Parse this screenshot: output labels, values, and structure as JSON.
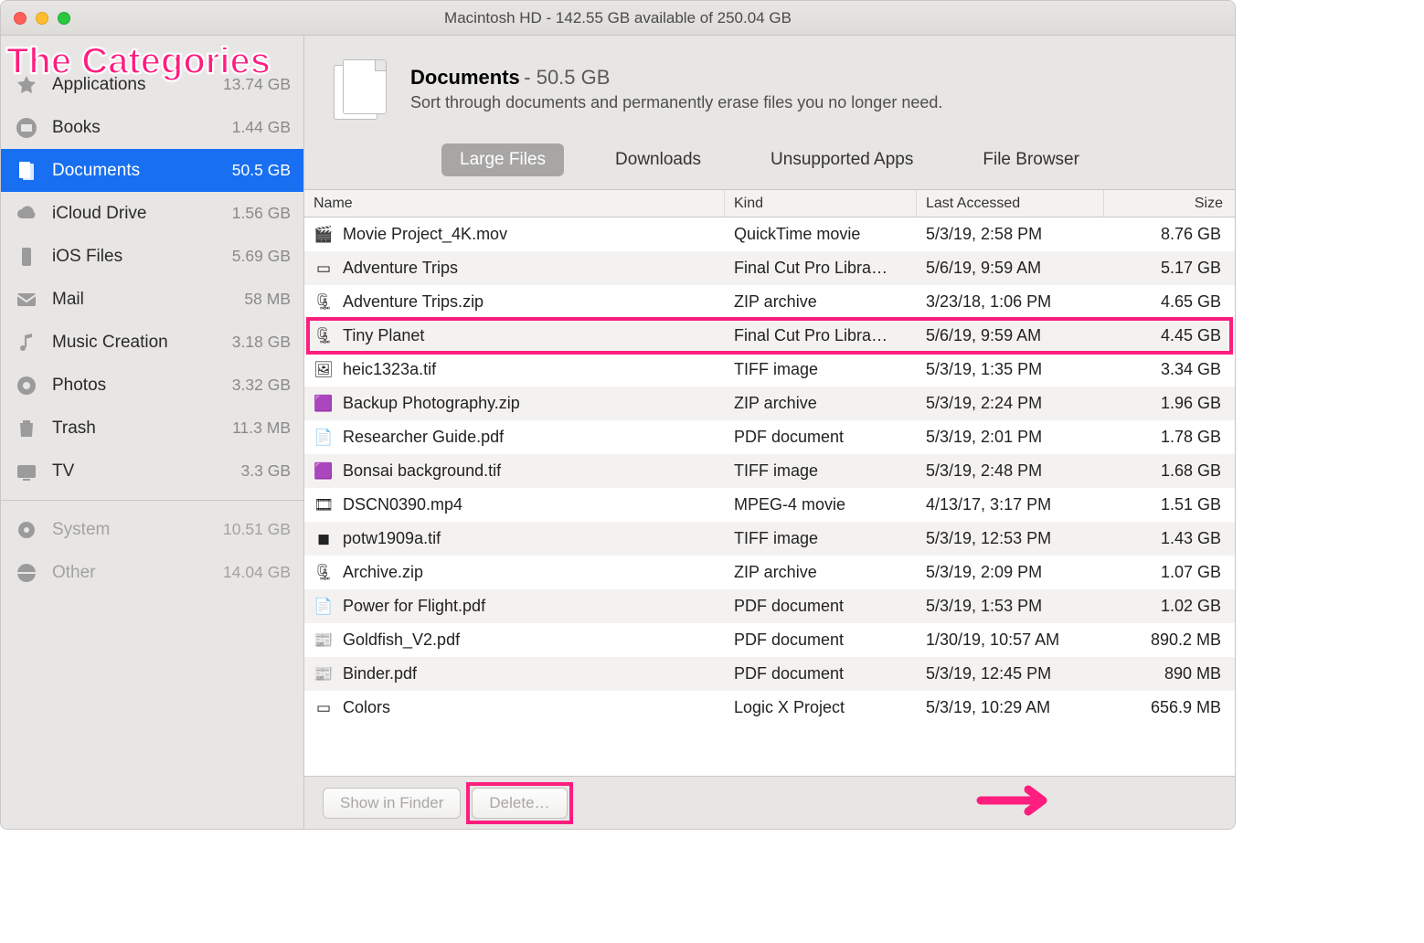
{
  "window_title": "Macintosh HD - 142.55 GB available of 250.04 GB",
  "annotation_title": "The Categories",
  "sidebar": {
    "items": [
      {
        "label": "Applications",
        "size": "13.74 GB",
        "icon": "applications-icon"
      },
      {
        "label": "Books",
        "size": "1.44 GB",
        "icon": "books-icon"
      },
      {
        "label": "Documents",
        "size": "50.5 GB",
        "icon": "documents-icon",
        "selected": true
      },
      {
        "label": "iCloud Drive",
        "size": "1.56 GB",
        "icon": "icloud-icon"
      },
      {
        "label": "iOS Files",
        "size": "5.69 GB",
        "icon": "ios-icon"
      },
      {
        "label": "Mail",
        "size": "58 MB",
        "icon": "mail-icon"
      },
      {
        "label": "Music Creation",
        "size": "3.18 GB",
        "icon": "music-icon"
      },
      {
        "label": "Photos",
        "size": "3.32 GB",
        "icon": "photos-icon"
      },
      {
        "label": "Trash",
        "size": "11.3 MB",
        "icon": "trash-icon"
      },
      {
        "label": "TV",
        "size": "3.3 GB",
        "icon": "tv-icon"
      }
    ],
    "secondary": [
      {
        "label": "System",
        "size": "10.51 GB",
        "icon": "system-icon"
      },
      {
        "label": "Other",
        "size": "14.04 GB",
        "icon": "other-icon"
      }
    ]
  },
  "header": {
    "title": "Documents",
    "size": "50.5 GB",
    "desc": "Sort through documents and permanently erase files you no longer need."
  },
  "tabs": [
    {
      "label": "Large Files",
      "active": true
    },
    {
      "label": "Downloads"
    },
    {
      "label": "Unsupported Apps"
    },
    {
      "label": "File Browser"
    }
  ],
  "columns": {
    "name": "Name",
    "kind": "Kind",
    "date": "Last Accessed",
    "size": "Size"
  },
  "files": [
    {
      "name": "Movie Project_4K.mov",
      "kind": "QuickTime movie",
      "date": "5/3/19, 2:58 PM",
      "size": "8.76 GB",
      "icon": "🎬"
    },
    {
      "name": "Adventure Trips",
      "kind": "Final Cut Pro Libra…",
      "date": "5/6/19, 9:59 AM",
      "size": "5.17 GB",
      "icon": "▭"
    },
    {
      "name": "Adventure Trips.zip",
      "kind": "ZIP archive",
      "date": "3/23/18, 1:06 PM",
      "size": "4.65 GB",
      "icon": "🗜"
    },
    {
      "name": "Tiny Planet",
      "kind": "Final Cut Pro Libra…",
      "date": "5/6/19, 9:59 AM",
      "size": "4.45 GB",
      "icon": "🗜",
      "hl": true
    },
    {
      "name": "heic1323a.tif",
      "kind": "TIFF image",
      "date": "5/3/19, 1:35 PM",
      "size": "3.34 GB",
      "icon": "🖼"
    },
    {
      "name": "Backup Photography.zip",
      "kind": "ZIP archive",
      "date": "5/3/19, 2:24 PM",
      "size": "1.96 GB",
      "icon": "🟪"
    },
    {
      "name": "Researcher Guide.pdf",
      "kind": "PDF document",
      "date": "5/3/19, 2:01 PM",
      "size": "1.78 GB",
      "icon": "📄"
    },
    {
      "name": "Bonsai background.tif",
      "kind": "TIFF image",
      "date": "5/3/19, 2:48 PM",
      "size": "1.68 GB",
      "icon": "🟪"
    },
    {
      "name": "DSCN0390.mp4",
      "kind": "MPEG-4 movie",
      "date": "4/13/17, 3:17 PM",
      "size": "1.51 GB",
      "icon": "🎞"
    },
    {
      "name": "potw1909a.tif",
      "kind": "TIFF image",
      "date": "5/3/19, 12:53 PM",
      "size": "1.43 GB",
      "icon": "◼"
    },
    {
      "name": "Archive.zip",
      "kind": "ZIP archive",
      "date": "5/3/19, 2:09 PM",
      "size": "1.07 GB",
      "icon": "🗜"
    },
    {
      "name": "Power for Flight.pdf",
      "kind": "PDF document",
      "date": "5/3/19, 1:53 PM",
      "size": "1.02 GB",
      "icon": "📄"
    },
    {
      "name": "Goldfish_V2.pdf",
      "kind": "PDF document",
      "date": "1/30/19, 10:57 AM",
      "size": "890.2 MB",
      "icon": "📰"
    },
    {
      "name": "Binder.pdf",
      "kind": "PDF document",
      "date": "5/3/19, 12:45 PM",
      "size": "890 MB",
      "icon": "📰"
    },
    {
      "name": "Colors",
      "kind": "Logic X Project",
      "date": "5/3/19, 10:29 AM",
      "size": "656.9 MB",
      "icon": "▭"
    }
  ],
  "footer": {
    "show_in_finder": "Show in Finder",
    "delete": "Delete…"
  }
}
